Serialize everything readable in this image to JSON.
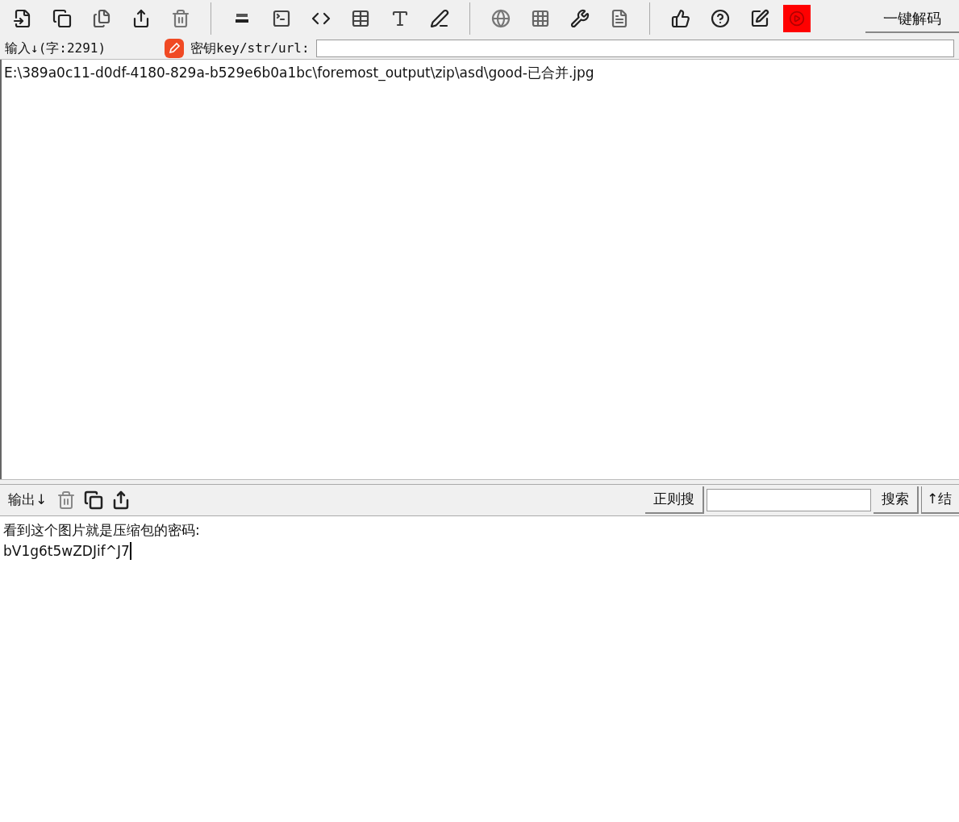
{
  "toolbar": {
    "decode_button": "一键解码"
  },
  "input_bar": {
    "label": "输入↓(字:2291)",
    "key_label": "密钥key/str/url:"
  },
  "input_text": "E:\\389a0c11-d0df-4180-829a-b529e6b0a1bc\\foremost_output\\zip\\asd\\good-已合并.jpg",
  "output_bar": {
    "label": "输出↓",
    "regex_button": "正则搜",
    "search_button": "搜索",
    "result_button": "↑结"
  },
  "output_lines": [
    "看到这个图片就是压缩包的密码:",
    "bV1g6t5wZDJif^J7"
  ]
}
